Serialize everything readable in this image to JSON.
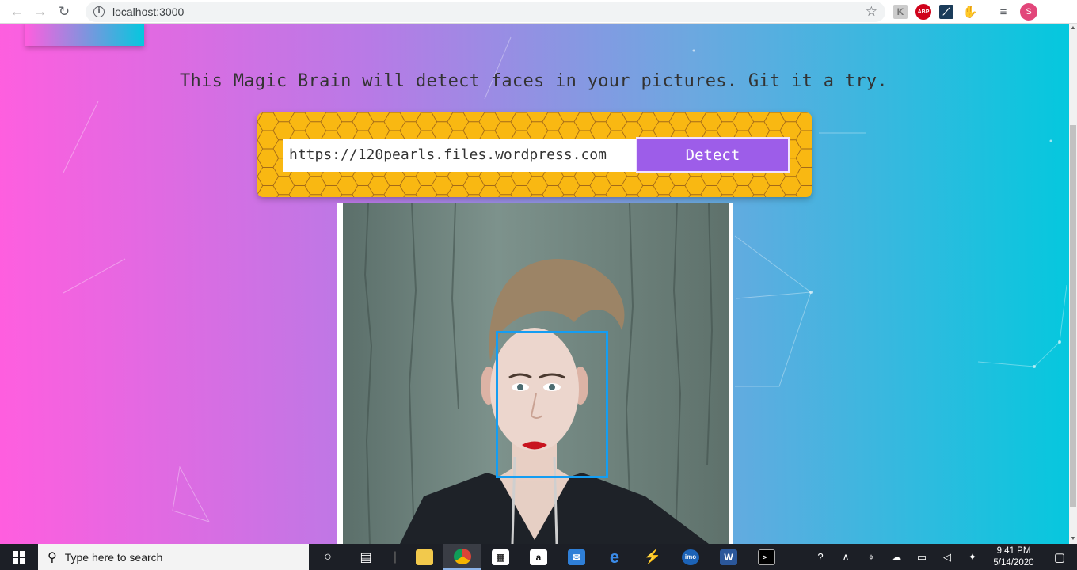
{
  "browser": {
    "back_icon": "←",
    "forward_icon": "→",
    "reload_icon": "↻",
    "address": "localhost:3000",
    "info_icon": "i",
    "bookmark_icon": "☆",
    "profile_initial": "S",
    "extensions": [
      "k-icon",
      "abp-icon",
      "blue-extension-icon",
      "hand-icon",
      "media-control-icon"
    ],
    "abp_label": "ABP",
    "k_label": "K"
  },
  "app": {
    "tagline": "This Magic Brain will detect faces in your pictures. Git it a try.",
    "image_url_value": "https://120pearls.files.wordpress.com",
    "detect_label": "Detect",
    "colors": {
      "gradient_start": "#ff5edf",
      "gradient_end": "#04c8de",
      "panel": "#f9b812",
      "button": "#9d5de9",
      "face_box": "#149df2"
    }
  },
  "taskbar": {
    "search_placeholder": "Type here to search",
    "pinned_apps": [
      "cortana-icon",
      "task-view-icon",
      "file-explorer-icon",
      "chrome-icon",
      "store-icon",
      "amazon-icon",
      "mail-icon",
      "edge-icon",
      "visual-studio-icon",
      "imo-icon",
      "word-icon",
      "terminal-icon"
    ],
    "amazon_label": "a",
    "imo_label": "imo",
    "word_label": "W",
    "time": "9:41 PM",
    "date": "5/14/2020"
  }
}
